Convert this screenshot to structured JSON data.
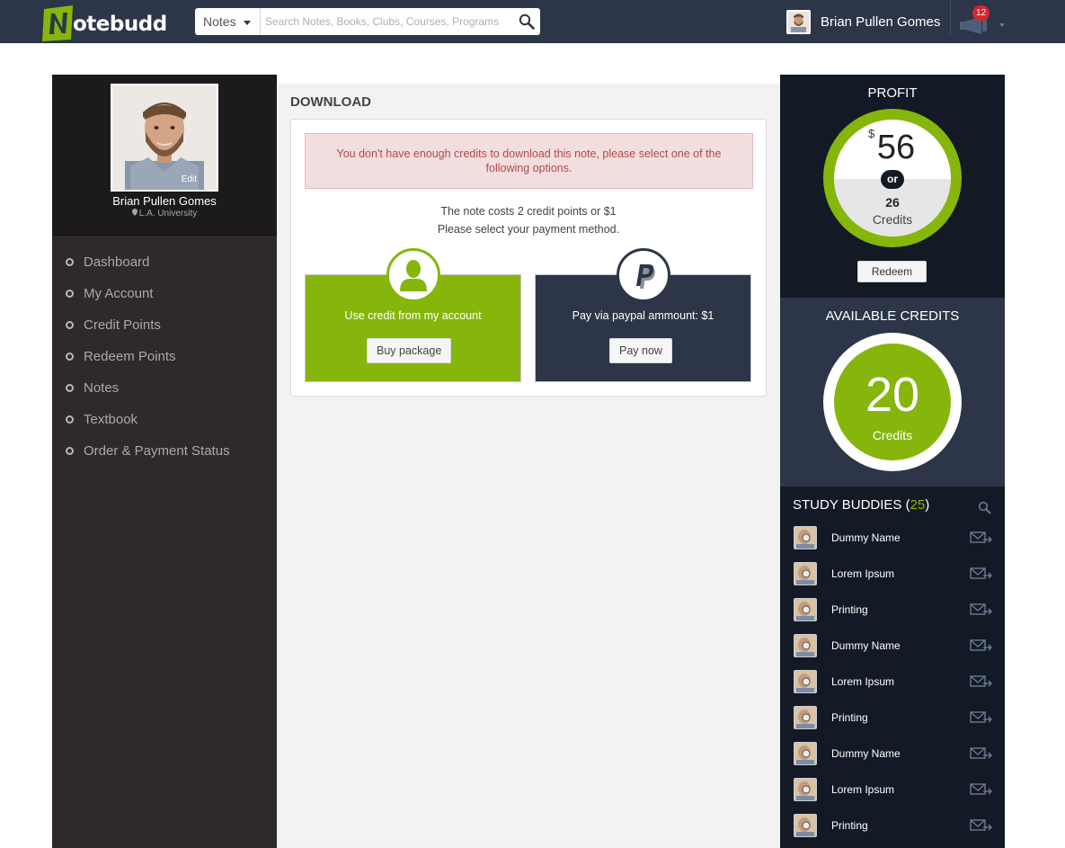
{
  "header": {
    "logo_text": "otebudd",
    "search_category": "Notes",
    "search_placeholder": "Search Notes, Books, Clubs, Courses, Programs",
    "user_name": "Brian Pullen Gomes",
    "notification_count": "12"
  },
  "profile": {
    "name": "Brian Pullen Gomes",
    "school": "L.A. University",
    "edit_label": "Edit"
  },
  "nav": [
    "Dashboard",
    "My Account",
    "Credit Points",
    "Redeem Points",
    "Notes",
    "Textbook",
    "Order & Payment Status"
  ],
  "download": {
    "title": "DOWNLOAD",
    "alert": "You don't have enough credits to download this note, please select one of the following options.",
    "cost_line": "The note costs 2 credit points or $1",
    "select_line": "Please select your payment method.",
    "option_credit_text": "Use credit from my account",
    "option_credit_button": "Buy package",
    "option_paypal_text": "Pay via paypal ammount: $1",
    "option_paypal_button": "Pay now"
  },
  "profit": {
    "title": "PROFIT",
    "currency": "$",
    "amount": "56",
    "or": "or",
    "credits": "26",
    "credits_label": "Credits",
    "redeem_button": "Redeem"
  },
  "available": {
    "title": "AVAILABLE CREDITS",
    "amount": "20",
    "label": "Credits"
  },
  "buddies": {
    "title": "STUDY BUDDIES (",
    "count": "25",
    "title_end": ")",
    "list": [
      "Dummy Name",
      "Lorem Ipsum",
      "Printing",
      "Dummy Name",
      "Lorem Ipsum",
      "Printing",
      "Dummy Name",
      "Lorem Ipsum",
      "Printing"
    ]
  },
  "colors": {
    "accent_green": "#86b60c",
    "navy": "#2c3648",
    "dark": "#131a26"
  }
}
